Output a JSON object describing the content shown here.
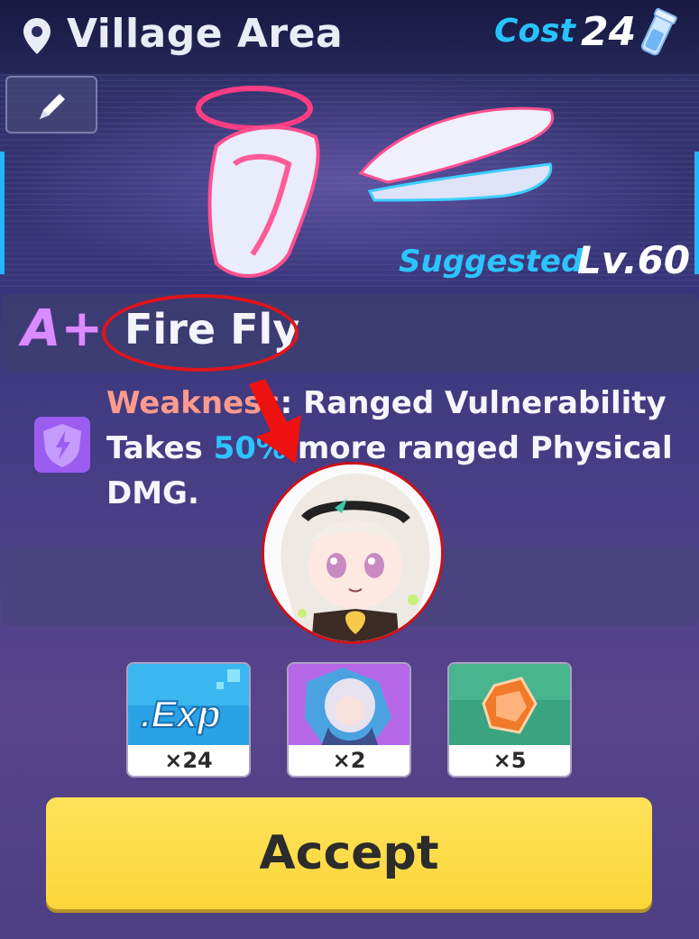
{
  "header": {
    "location_icon": "location-pin-icon",
    "location": "Village Area",
    "cost_label": "Cost",
    "cost_value": "24",
    "cost_icon": "energy-vial-icon"
  },
  "banner": {
    "edit_icon": "pencil-icon",
    "suggested_label": "Suggested",
    "suggested_level": "Lv.60"
  },
  "boss": {
    "grade": "A+",
    "name": "Fire Fly",
    "weakness_icon": "shield-lightning-icon",
    "weakness_label": "Weakness",
    "weakness_colon": ":",
    "weakness_type": "Ranged Vulnerability",
    "desc_prefix": "Takes",
    "desc_percent": "50%",
    "desc_suffix": "more ranged Physical DMG."
  },
  "rewards": [
    {
      "icon": "exp-icon",
      "text": ".Exp",
      "qty": "×24"
    },
    {
      "icon": "character-fragment-icon",
      "qty": "×2"
    },
    {
      "icon": "orange-crystal-icon",
      "qty": "×5"
    }
  ],
  "accept_label": "Accept",
  "colors": {
    "accent_blue": "#27c3ff",
    "weakness_red": "#ff9a8c",
    "grade_purple": "#d98cff",
    "button_yellow": "#fcd63a",
    "annotation_red": "#e0141c"
  }
}
